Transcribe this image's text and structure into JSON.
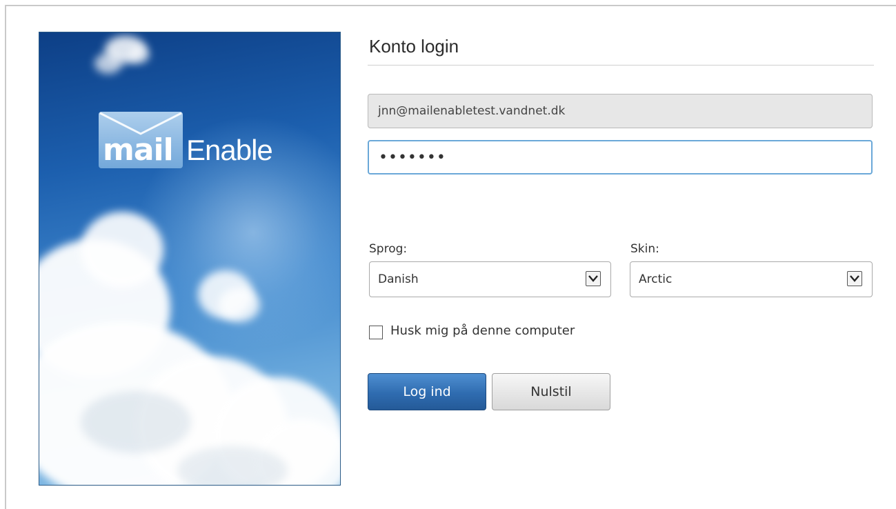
{
  "branding": {
    "logo_mail": "mail",
    "logo_enable": "Enable"
  },
  "form": {
    "title": "Konto login",
    "email_value": "jnn@mailenabletest.vandnet.dk",
    "password_mask": "•••••••",
    "language_label": "Sprog:",
    "language_value": "Danish",
    "skin_label": "Skin:",
    "skin_value": "Arctic",
    "remember_label": "Husk mig på denne computer",
    "remember_checked": false,
    "login_button": "Log ind",
    "reset_button": "Nulstil"
  },
  "colors": {
    "accent": "#2f6cb0",
    "focus_border": "#6aa8d8"
  }
}
